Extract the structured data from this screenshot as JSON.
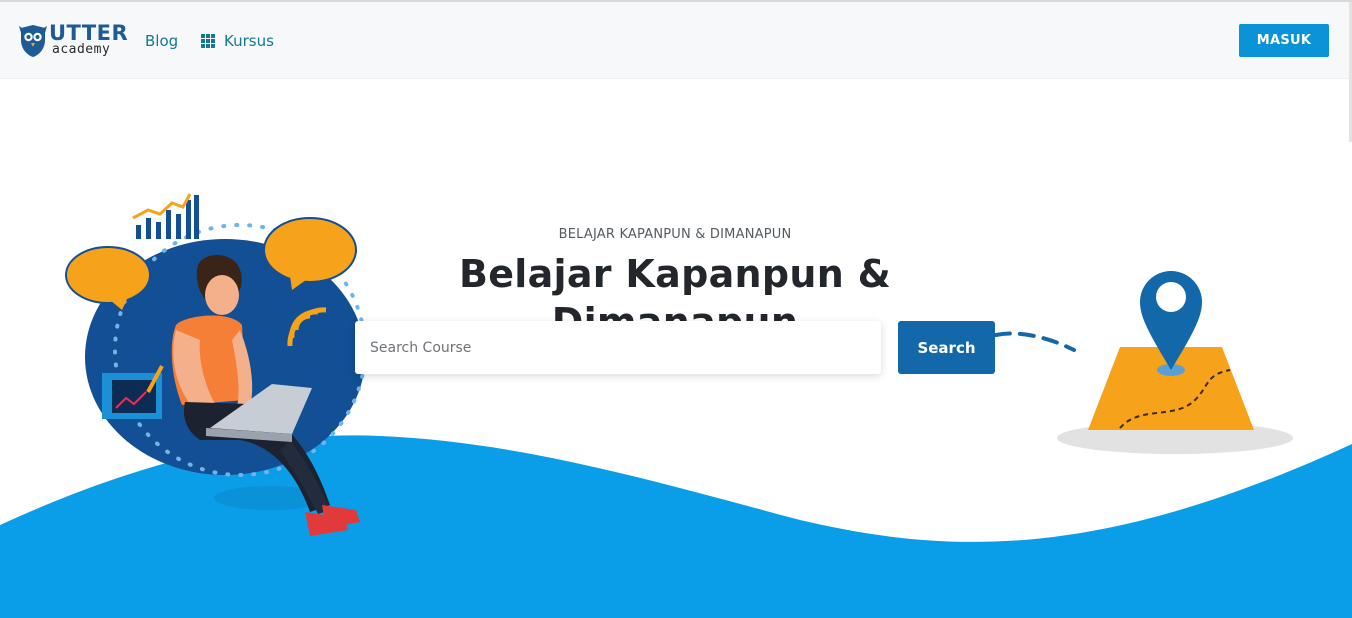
{
  "brand": {
    "name_top": "UTTER",
    "name_bottom": "academy",
    "logo_icon": "owl-shield-icon",
    "primary_color": "#1d5a96"
  },
  "nav": {
    "blog_label": "Blog",
    "kursus_label": "Kursus",
    "kursus_icon": "grid-icon",
    "login_label": "MASUK",
    "link_color": "#16788f",
    "login_color": "#0a93d6"
  },
  "hero": {
    "subtitle": "BELAJAR KAPANPUN & DIMANAPUN",
    "title": "Belajar Kapanpun & Dimanapun",
    "search_placeholder": "Search Course",
    "search_value": "",
    "search_button_label": "Search",
    "search_button_color": "#1268a8",
    "wave_color": "#0a9ee8",
    "illustrations": [
      "student-with-laptop-illustration",
      "map-location-pin-illustration"
    ]
  }
}
